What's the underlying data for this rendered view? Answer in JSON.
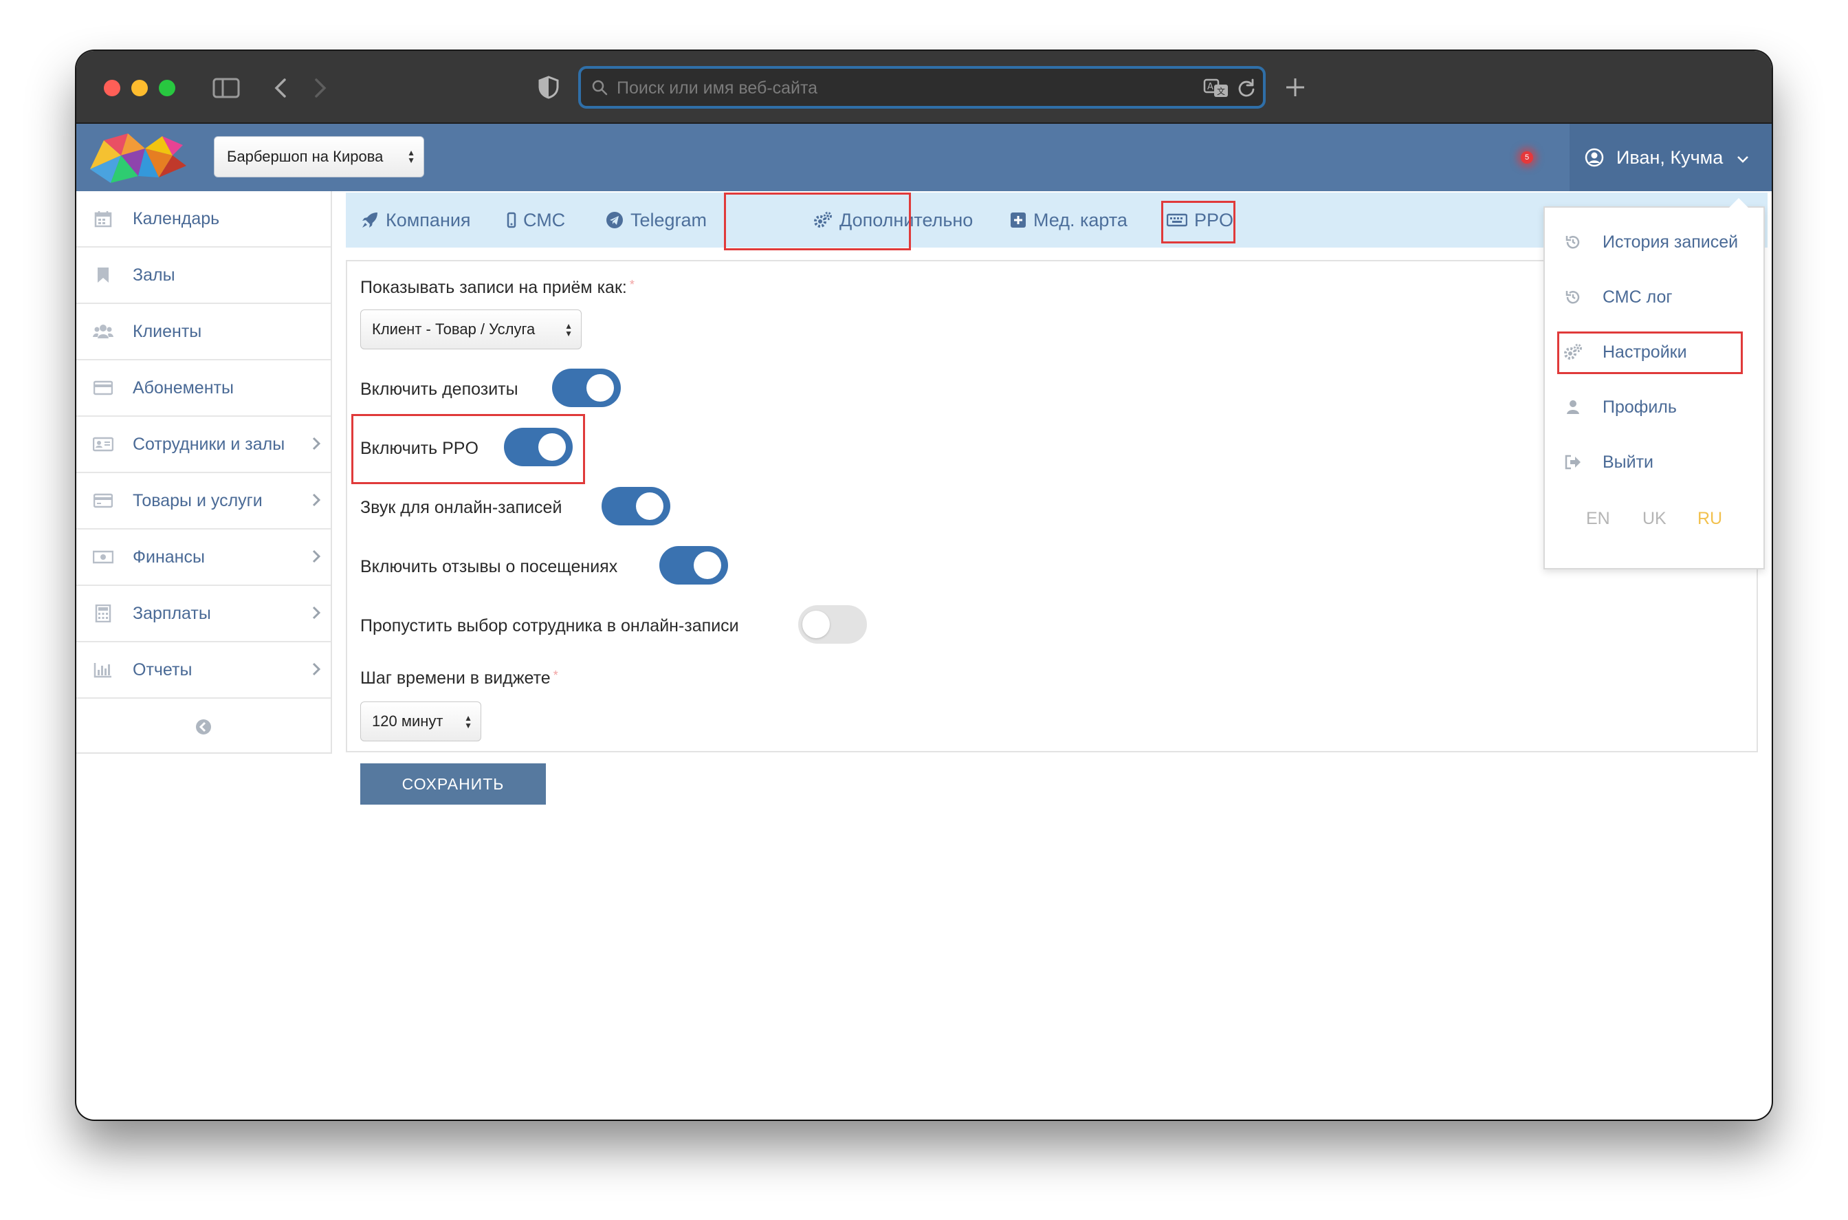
{
  "browser": {
    "url_placeholder": "Поиск или имя веб-сайта"
  },
  "header": {
    "branch_select": "Барбершоп на Кирова",
    "notification_count": "5",
    "user_name": "Иван, Кучма"
  },
  "sidebar": {
    "items": [
      {
        "label": "Календарь",
        "icon": "calendar-icon"
      },
      {
        "label": "Залы",
        "icon": "bookmark-icon"
      },
      {
        "label": "Клиенты",
        "icon": "users-icon"
      },
      {
        "label": "Абонементы",
        "icon": "card-icon"
      },
      {
        "label": "Сотрудники и залы",
        "icon": "id-card-icon"
      },
      {
        "label": "Товары и услуги",
        "icon": "credit-card-icon"
      },
      {
        "label": "Финансы",
        "icon": "money-icon"
      },
      {
        "label": "Зарплаты",
        "icon": "calculator-icon"
      },
      {
        "label": "Отчеты",
        "icon": "bar-chart-icon"
      }
    ]
  },
  "tabs": [
    {
      "label": "Компания",
      "icon": "rocket-icon"
    },
    {
      "label": "СМС",
      "icon": "mobile-icon"
    },
    {
      "label": "Telegram",
      "icon": "telegram-icon"
    },
    {
      "label": "Дополнительно",
      "icon": "gears-icon"
    },
    {
      "label": "Мед. карта",
      "icon": "plus-square-icon"
    },
    {
      "label": "PPO",
      "icon": "keyboard-icon"
    }
  ],
  "form": {
    "display_label": "Показывать записи на приём как:",
    "display_value": "Клиент - Товар / Услуга",
    "toggles": [
      {
        "label": "Включить депозиты",
        "on": true
      },
      {
        "label": "Включить PPO",
        "on": true
      },
      {
        "label": "Звук для онлайн-записей",
        "on": true
      },
      {
        "label": "Включить отзывы о посещениях",
        "on": true
      },
      {
        "label": "Пропустить выбор сотрудника в онлайн-записи",
        "on": false
      }
    ],
    "time_step_label": "Шаг времени в виджете",
    "time_step_value": "120 минут",
    "save_label": "СОХРАНИТЬ"
  },
  "dropdown": {
    "items": [
      {
        "label": "История записей",
        "icon": "history-icon"
      },
      {
        "label": "СМС лог",
        "icon": "history-icon"
      },
      {
        "label": "Настройки",
        "icon": "gears-icon"
      },
      {
        "label": "Профиль",
        "icon": "user-icon"
      },
      {
        "label": "Выйти",
        "icon": "sign-out-icon"
      }
    ],
    "languages": [
      "EN",
      "UK",
      "RU"
    ],
    "active_language": "RU"
  },
  "colors": {
    "header": "#5478a4",
    "accent": "#3a72b0",
    "highlight": "#e03a3a",
    "active_language": "#f2c14e"
  }
}
